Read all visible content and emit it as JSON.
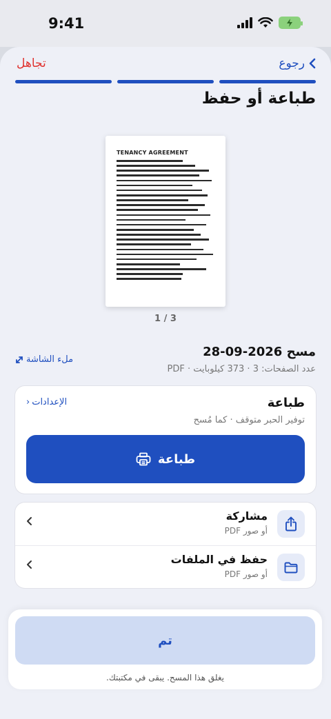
{
  "status_bar": {
    "time": "9:41"
  },
  "nav": {
    "back_label": "رجوع",
    "skip_label": "تجاهل"
  },
  "page": {
    "title": "طباعة أو حفظ"
  },
  "preview": {
    "document_heading": "TENANCY AGREEMENT",
    "page_indicator": "1 / 3",
    "fullscreen_label": "ملء الشاشة"
  },
  "scan": {
    "title": "مسح 2026-09-28",
    "meta": "عدد الصفحات: 3 · 373 كيلوبايت · PDF"
  },
  "print_card": {
    "heading": "طباعة",
    "subtitle": "توفير الحبر متوقف · كما مُسح",
    "settings_label": "الإعدادات",
    "button_label": "طباعة"
  },
  "actions": [
    {
      "title": "مشاركة",
      "subtitle": "أو صور PDF",
      "icon": "share-icon"
    },
    {
      "title": "حفظ في الملفات",
      "subtitle": "أو صور PDF",
      "icon": "folder-icon"
    }
  ],
  "footer": {
    "done_label": "تم",
    "note": "يغلق هذا المسح. يبقى في مكتبتك."
  },
  "colors": {
    "accent": "#1f4fbf",
    "danger": "#e0322f",
    "done_bg": "#cfdbf3",
    "battery": "#8bd17c"
  }
}
